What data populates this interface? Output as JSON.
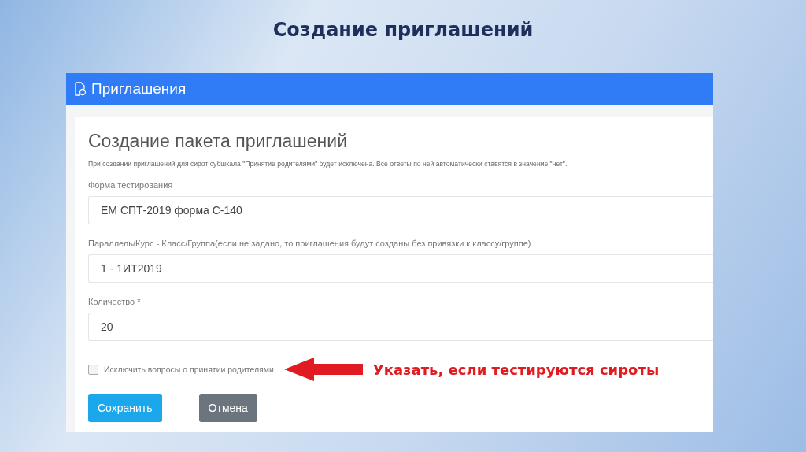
{
  "slide_title": "Создание приглашений",
  "panel": {
    "title": "Приглашения"
  },
  "form": {
    "heading": "Создание пакета приглашений",
    "note": "При создании приглашений для сирот субшкала \"Принятие родителями\" будет исключена. Все ответы по ней автоматически ставятся в значение \"нет\".",
    "fields": [
      {
        "label": "Форма тестирования",
        "value": "ЕМ СПТ-2019 форма С-140"
      },
      {
        "label": "Параллель/Курс - Класс/Группа(если не задано, то приглашения будут созданы без привязки к классу/группе)",
        "value": "1 - 1ИТ2019"
      },
      {
        "label": "Количество *",
        "value": "20"
      }
    ],
    "checkbox": {
      "label": "Исключить вопросы о принятии родителями",
      "checked": false
    },
    "buttons": [
      {
        "label": "Сохранить",
        "kind": "primary"
      },
      {
        "label": "Отмена",
        "kind": "secondary"
      }
    ]
  },
  "annotation": {
    "text": "Указать, если тестируются сироты"
  }
}
